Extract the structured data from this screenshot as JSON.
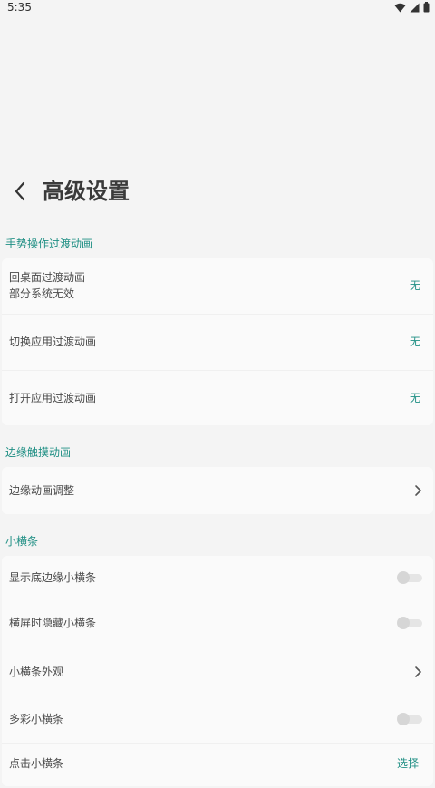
{
  "status": {
    "time": "5:35",
    "icons": [
      "wifi-icon",
      "signal-icon",
      "battery-icon"
    ]
  },
  "header": {
    "title": "高级设置",
    "back_icon": "chevron-left-icon"
  },
  "colors": {
    "accent": "#1f8f84",
    "background": "#f4f4f4",
    "card": "#fafafa",
    "text": "#4a4a4a"
  },
  "sections": {
    "gesture": {
      "title": "手势操作过渡动画",
      "items": [
        {
          "label": "回桌面过渡动画",
          "sublabel": "部分系统无效",
          "value": "无"
        },
        {
          "label": "切换应用过渡动画",
          "value": "无"
        },
        {
          "label": "打开应用过渡动画",
          "value": "无"
        }
      ]
    },
    "edge": {
      "title": "边缘触摸动画",
      "items": [
        {
          "label": "边缘动画调整"
        }
      ]
    },
    "bar": {
      "title": "小横条",
      "items": [
        {
          "label": "显示底边缘小横条",
          "toggle": false
        },
        {
          "label": "横屏时隐藏小横条",
          "toggle": false
        },
        {
          "label": "小横条外观"
        },
        {
          "label": "多彩小横条",
          "toggle": false
        },
        {
          "label": "点击小横条",
          "value": "选择"
        }
      ]
    }
  }
}
